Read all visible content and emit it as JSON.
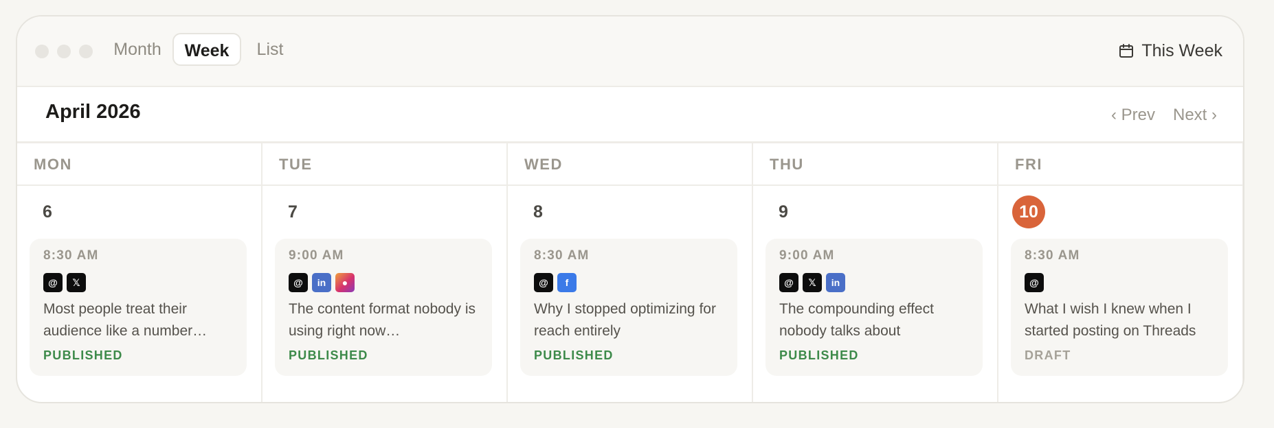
{
  "tabs": [
    {
      "label": "Month"
    },
    {
      "label": "Week"
    },
    {
      "label": "List"
    }
  ],
  "active_tab": "Week",
  "this_week_label": "This Week",
  "month_title": "April 2026",
  "nav": {
    "prev": "‹ Prev",
    "next": "Next ›"
  },
  "accent_color": "#d9643a",
  "days": [
    {
      "name": "MON",
      "num": "6",
      "today": false,
      "post": {
        "time": "8:30 AM",
        "platforms": [
          "threads-icon",
          "x-icon"
        ],
        "text": "Most people treat their audience like a number…",
        "status": "PUBLISHED"
      }
    },
    {
      "name": "TUE",
      "num": "7",
      "today": false,
      "post": {
        "time": "9:00 AM",
        "platforms": [
          "threads-icon",
          "linkedin-icon",
          "instagram-icon"
        ],
        "text": "The content format nobody is using right now…",
        "status": "PUBLISHED"
      }
    },
    {
      "name": "WED",
      "num": "8",
      "today": false,
      "post": {
        "time": "8:30 AM",
        "platforms": [
          "threads-icon",
          "facebook-icon"
        ],
        "text": "Why I stopped optimizing for reach entirely",
        "status": "PUBLISHED"
      }
    },
    {
      "name": "THU",
      "num": "9",
      "today": false,
      "post": {
        "time": "9:00 AM",
        "platforms": [
          "threads-icon",
          "x-icon",
          "linkedin-icon"
        ],
        "text": "The compounding effect nobody talks about",
        "status": "PUBLISHED"
      }
    },
    {
      "name": "FRI",
      "num": "10",
      "today": true,
      "post": {
        "time": "8:30 AM",
        "platforms": [
          "threads-icon"
        ],
        "text": "What I wish I knew when I started posting on Threads",
        "status": "DRAFT"
      }
    }
  ]
}
